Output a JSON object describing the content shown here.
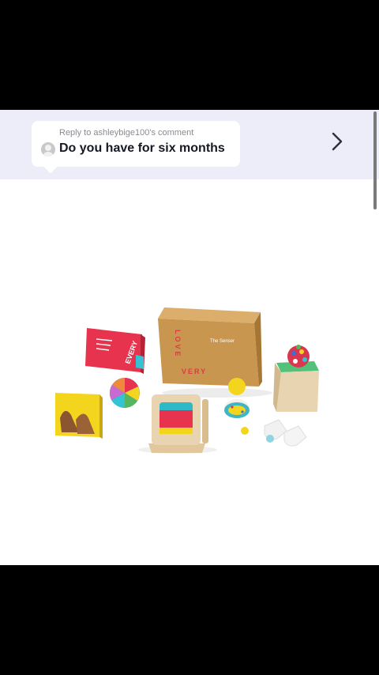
{
  "reply": {
    "label": "Reply to ashleybige100's comment",
    "text": "Do you have for six months",
    "avatar_icon": "default-avatar-icon"
  },
  "navigation": {
    "next_icon": "chevron-right-icon"
  },
  "product": {
    "box_brand_vertical": "LOVE",
    "box_brand_horizontal": "VERY",
    "box_label": "The Senser",
    "book_red_text": "EVERY"
  },
  "colors": {
    "banner_bg": "#ecedf8",
    "box_kraft": "#c9964f",
    "brand_red": "#e2364a",
    "book_red": "#e8334f",
    "book_yellow": "#f4d51d"
  }
}
